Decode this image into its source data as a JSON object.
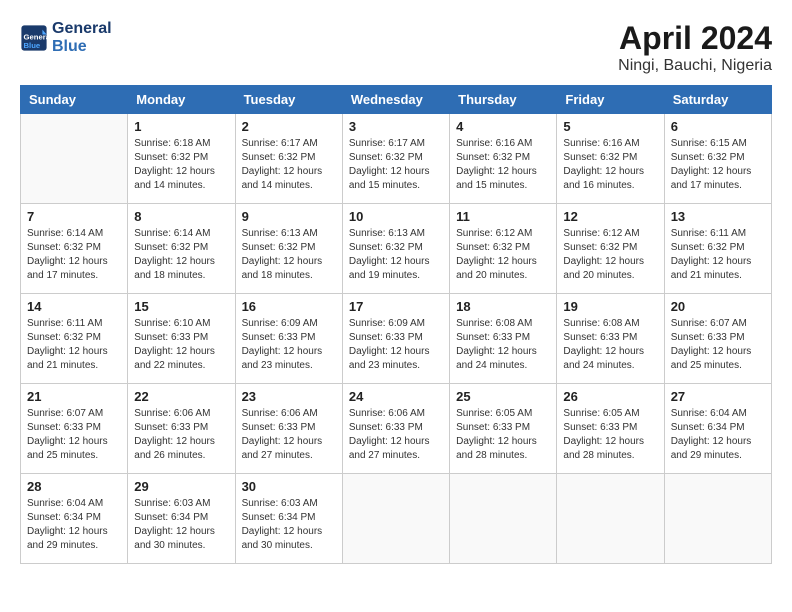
{
  "header": {
    "logo_line1": "General",
    "logo_line2": "Blue",
    "month": "April 2024",
    "location": "Ningi, Bauchi, Nigeria"
  },
  "columns": [
    "Sunday",
    "Monday",
    "Tuesday",
    "Wednesday",
    "Thursday",
    "Friday",
    "Saturday"
  ],
  "weeks": [
    [
      {
        "day": "",
        "info": ""
      },
      {
        "day": "1",
        "info": "Sunrise: 6:18 AM\nSunset: 6:32 PM\nDaylight: 12 hours\nand 14 minutes."
      },
      {
        "day": "2",
        "info": "Sunrise: 6:17 AM\nSunset: 6:32 PM\nDaylight: 12 hours\nand 14 minutes."
      },
      {
        "day": "3",
        "info": "Sunrise: 6:17 AM\nSunset: 6:32 PM\nDaylight: 12 hours\nand 15 minutes."
      },
      {
        "day": "4",
        "info": "Sunrise: 6:16 AM\nSunset: 6:32 PM\nDaylight: 12 hours\nand 15 minutes."
      },
      {
        "day": "5",
        "info": "Sunrise: 6:16 AM\nSunset: 6:32 PM\nDaylight: 12 hours\nand 16 minutes."
      },
      {
        "day": "6",
        "info": "Sunrise: 6:15 AM\nSunset: 6:32 PM\nDaylight: 12 hours\nand 17 minutes."
      }
    ],
    [
      {
        "day": "7",
        "info": "Sunrise: 6:14 AM\nSunset: 6:32 PM\nDaylight: 12 hours\nand 17 minutes."
      },
      {
        "day": "8",
        "info": "Sunrise: 6:14 AM\nSunset: 6:32 PM\nDaylight: 12 hours\nand 18 minutes."
      },
      {
        "day": "9",
        "info": "Sunrise: 6:13 AM\nSunset: 6:32 PM\nDaylight: 12 hours\nand 18 minutes."
      },
      {
        "day": "10",
        "info": "Sunrise: 6:13 AM\nSunset: 6:32 PM\nDaylight: 12 hours\nand 19 minutes."
      },
      {
        "day": "11",
        "info": "Sunrise: 6:12 AM\nSunset: 6:32 PM\nDaylight: 12 hours\nand 20 minutes."
      },
      {
        "day": "12",
        "info": "Sunrise: 6:12 AM\nSunset: 6:32 PM\nDaylight: 12 hours\nand 20 minutes."
      },
      {
        "day": "13",
        "info": "Sunrise: 6:11 AM\nSunset: 6:32 PM\nDaylight: 12 hours\nand 21 minutes."
      }
    ],
    [
      {
        "day": "14",
        "info": "Sunrise: 6:11 AM\nSunset: 6:32 PM\nDaylight: 12 hours\nand 21 minutes."
      },
      {
        "day": "15",
        "info": "Sunrise: 6:10 AM\nSunset: 6:33 PM\nDaylight: 12 hours\nand 22 minutes."
      },
      {
        "day": "16",
        "info": "Sunrise: 6:09 AM\nSunset: 6:33 PM\nDaylight: 12 hours\nand 23 minutes."
      },
      {
        "day": "17",
        "info": "Sunrise: 6:09 AM\nSunset: 6:33 PM\nDaylight: 12 hours\nand 23 minutes."
      },
      {
        "day": "18",
        "info": "Sunrise: 6:08 AM\nSunset: 6:33 PM\nDaylight: 12 hours\nand 24 minutes."
      },
      {
        "day": "19",
        "info": "Sunrise: 6:08 AM\nSunset: 6:33 PM\nDaylight: 12 hours\nand 24 minutes."
      },
      {
        "day": "20",
        "info": "Sunrise: 6:07 AM\nSunset: 6:33 PM\nDaylight: 12 hours\nand 25 minutes."
      }
    ],
    [
      {
        "day": "21",
        "info": "Sunrise: 6:07 AM\nSunset: 6:33 PM\nDaylight: 12 hours\nand 25 minutes."
      },
      {
        "day": "22",
        "info": "Sunrise: 6:06 AM\nSunset: 6:33 PM\nDaylight: 12 hours\nand 26 minutes."
      },
      {
        "day": "23",
        "info": "Sunrise: 6:06 AM\nSunset: 6:33 PM\nDaylight: 12 hours\nand 27 minutes."
      },
      {
        "day": "24",
        "info": "Sunrise: 6:06 AM\nSunset: 6:33 PM\nDaylight: 12 hours\nand 27 minutes."
      },
      {
        "day": "25",
        "info": "Sunrise: 6:05 AM\nSunset: 6:33 PM\nDaylight: 12 hours\nand 28 minutes."
      },
      {
        "day": "26",
        "info": "Sunrise: 6:05 AM\nSunset: 6:33 PM\nDaylight: 12 hours\nand 28 minutes."
      },
      {
        "day": "27",
        "info": "Sunrise: 6:04 AM\nSunset: 6:34 PM\nDaylight: 12 hours\nand 29 minutes."
      }
    ],
    [
      {
        "day": "28",
        "info": "Sunrise: 6:04 AM\nSunset: 6:34 PM\nDaylight: 12 hours\nand 29 minutes."
      },
      {
        "day": "29",
        "info": "Sunrise: 6:03 AM\nSunset: 6:34 PM\nDaylight: 12 hours\nand 30 minutes."
      },
      {
        "day": "30",
        "info": "Sunrise: 6:03 AM\nSunset: 6:34 PM\nDaylight: 12 hours\nand 30 minutes."
      },
      {
        "day": "",
        "info": ""
      },
      {
        "day": "",
        "info": ""
      },
      {
        "day": "",
        "info": ""
      },
      {
        "day": "",
        "info": ""
      }
    ]
  ]
}
